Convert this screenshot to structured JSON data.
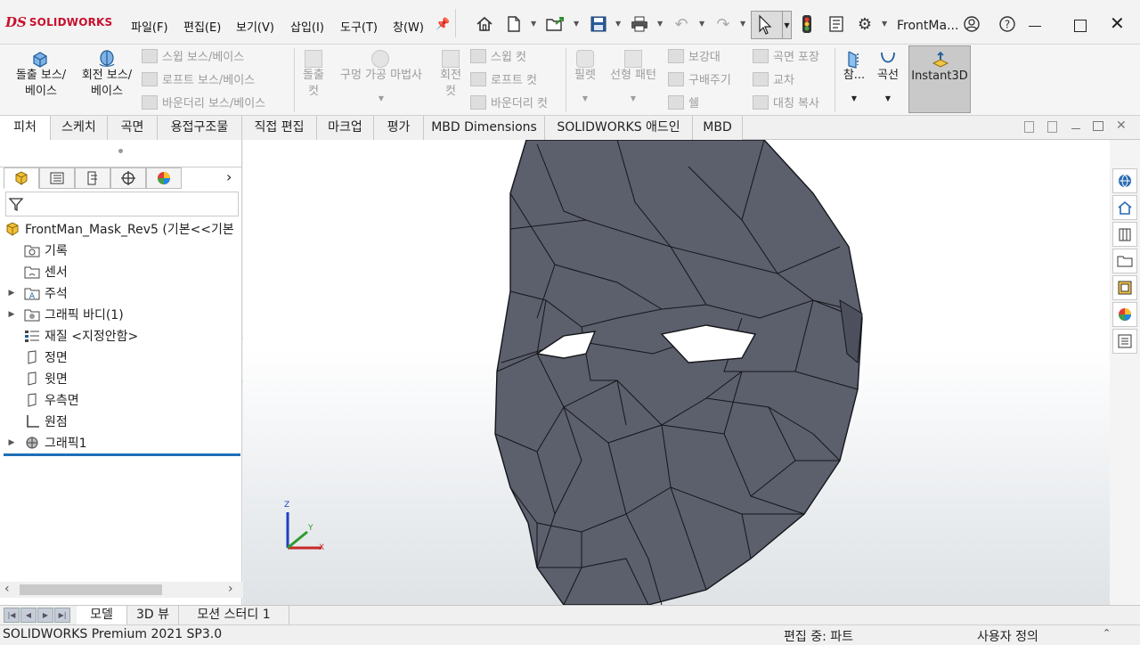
{
  "app": {
    "logo_ds": "DS",
    "logo_text": "SOLIDWORKS",
    "document_name": "FrontMa...",
    "menus": [
      "파일(F)",
      "편집(E)",
      "보기(V)",
      "삽입(I)",
      "도구(T)",
      "창(W)"
    ]
  },
  "ribbon": {
    "extrude_boss": [
      "돌출 보스/",
      "베이스"
    ],
    "revolve_boss": [
      "회전 보스/",
      "베이스"
    ],
    "sweep_boss": "스윕 보스/베이스",
    "loft_boss": "로프트 보스/베이스",
    "boundary_boss": "바운더리 보스/베이스",
    "extrude_cut": [
      "돌출",
      "컷"
    ],
    "hole_wizard": "구멍 가공 마법사",
    "revolve_cut": [
      "회전",
      "컷"
    ],
    "sweep_cut": "스윕 컷",
    "loft_cut": "로프트 컷",
    "boundary_cut": "바운더리 컷",
    "fillet": "필렛",
    "linear_pattern": "선형 패턴",
    "rib": "보강대",
    "draft": "구배주기",
    "shell": "쉘",
    "wrap": "곡면 포장",
    "intersect": "교차",
    "mirror": "대칭 복사",
    "reference": "참...",
    "curves": "곡선",
    "instant3d": "Instant3D"
  },
  "tabs": [
    "피처",
    "스케치",
    "곡면",
    "용접구조물",
    "직접 편집",
    "마크업",
    "평가",
    "MBD Dimensions",
    "SOLIDWORKS 애드인",
    "MBD"
  ],
  "tree": {
    "root": "FrontMan_Mask_Rev5  (기본<<기본",
    "items": [
      "기록",
      "센서",
      "주석",
      "그래픽 바디(1)",
      "재질 <지정안함>",
      "정면",
      "윗면",
      "우측면",
      "원점",
      "그래픽1"
    ]
  },
  "triad": {
    "x": "X",
    "y": "Y",
    "z": "Z"
  },
  "bottom_tabs": [
    "모델",
    "3D 뷰",
    "모션 스터디 1"
  ],
  "status": {
    "product": "SOLIDWORKS Premium 2021 SP3.0",
    "mode": "편집 중: 파트",
    "units": "사용자 정의"
  },
  "colors": {
    "accent_red": "#c8102e",
    "mask_fill": "#5c5f6c",
    "selection_blue": "#1f6fb5"
  }
}
